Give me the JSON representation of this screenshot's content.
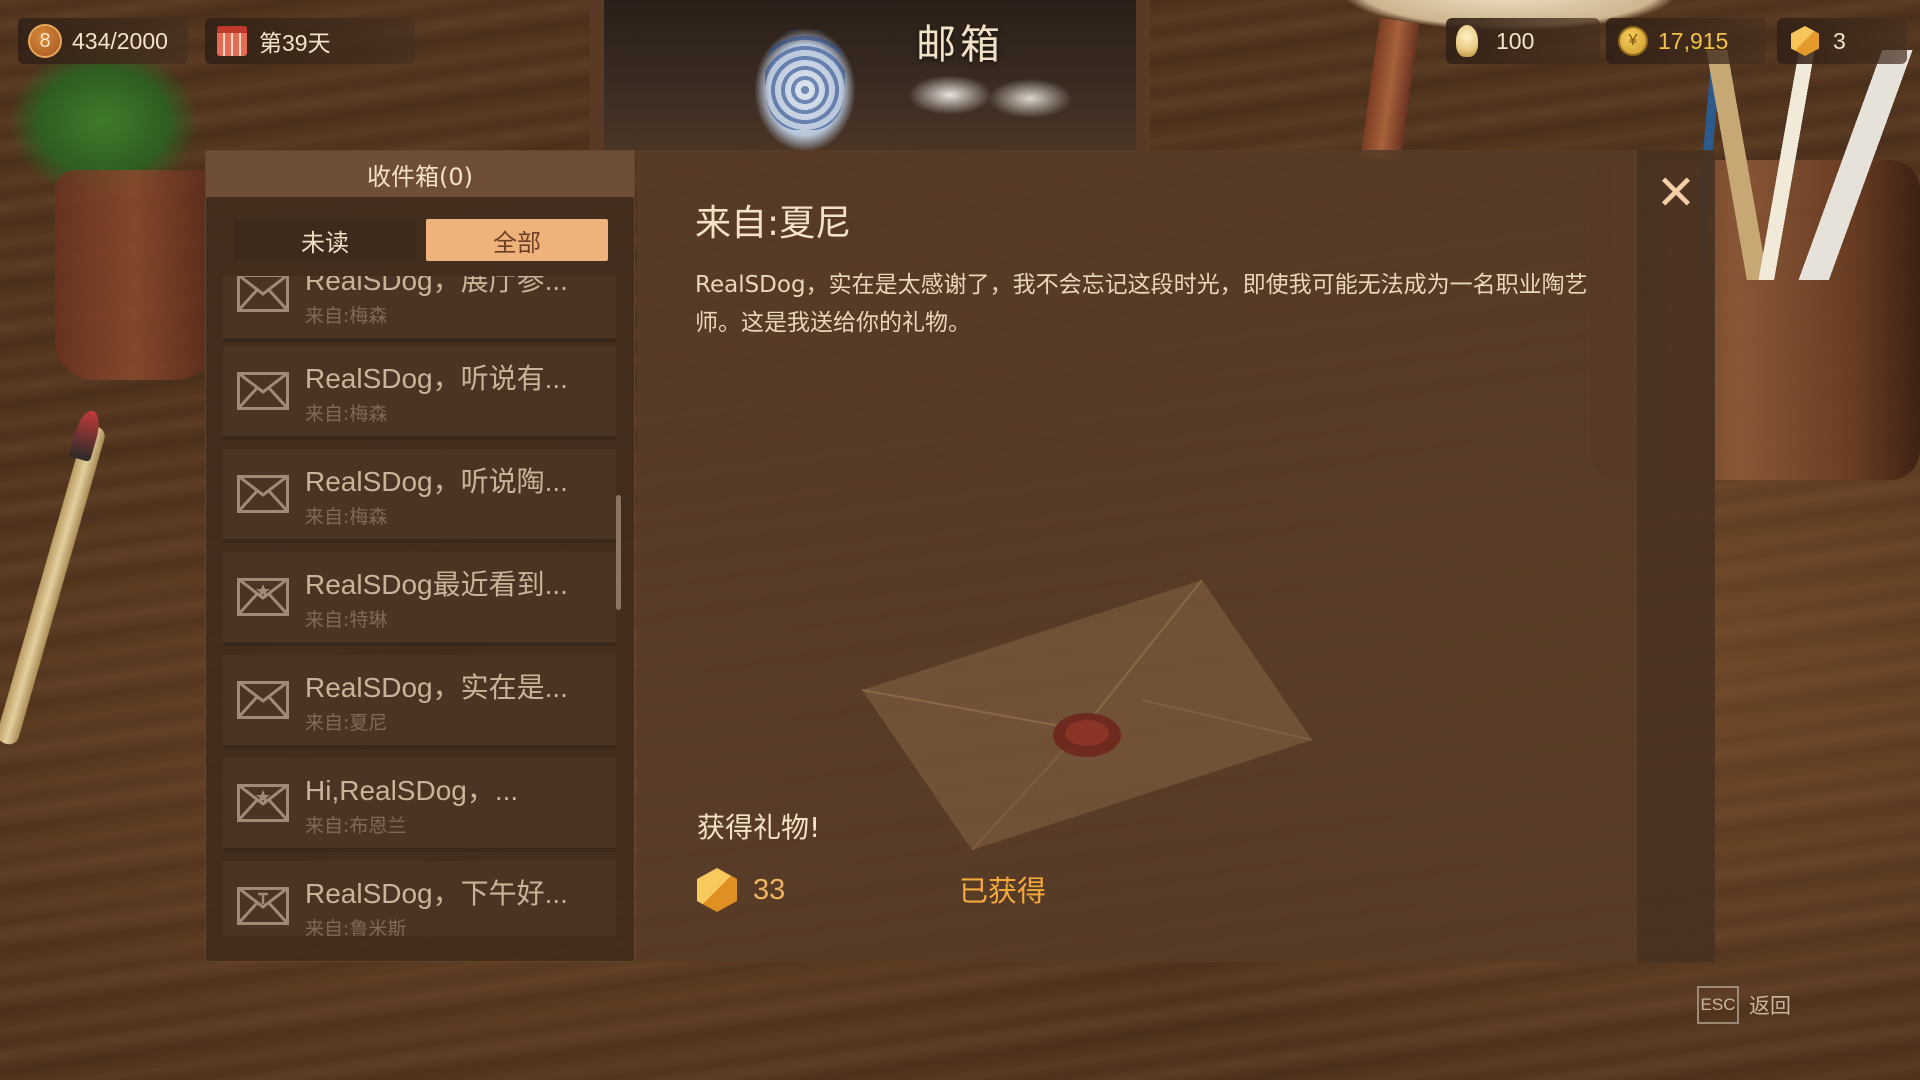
{
  "hud": {
    "level": "8",
    "exp": "434/2000",
    "day": "第39天",
    "inspiration": "100",
    "coins": "17,915",
    "cubes": "3"
  },
  "screen_title": "邮箱",
  "inbox": {
    "header": "收件箱(0)",
    "tabs": {
      "unread": "未读",
      "all": "全部"
    },
    "selected_tab": "all",
    "items": [
      {
        "subject": "RealSDog，展厅参...",
        "from": "来自:梅森",
        "icon": "envelope-icon"
      },
      {
        "subject": "RealSDog，听说有...",
        "from": "来自:梅森",
        "icon": "envelope-icon"
      },
      {
        "subject": "RealSDog，听说陶...",
        "from": "来自:梅森",
        "icon": "envelope-icon"
      },
      {
        "subject": "RealSDog最近看到...",
        "from": "来自:特琳",
        "icon": "envelope-star-icon"
      },
      {
        "subject": "RealSDog，实在是...",
        "from": "来自:夏尼",
        "icon": "envelope-icon"
      },
      {
        "subject": "Hi,RealSDog，...",
        "from": "来自:布恩兰",
        "icon": "envelope-star-icon"
      },
      {
        "subject": "RealSDog，下午好...",
        "from": "来自:鲁米斯",
        "icon": "envelope-t-icon"
      }
    ]
  },
  "detail": {
    "from": "来自:夏尼",
    "body": "RealSDog，实在是太感谢了，我不会忘记这段时光，即使我可能无法成为一名职业陶艺师。这是我送给你的礼物。",
    "gift_title": "获得礼物!",
    "gift_count": "33",
    "gift_status": "已获得"
  },
  "esc_hint": {
    "key": "ESC",
    "label": "返回"
  },
  "colors": {
    "tab_active": "#f0b27b",
    "gift_status": "#f5a93d",
    "close": "#f6cfa6"
  }
}
